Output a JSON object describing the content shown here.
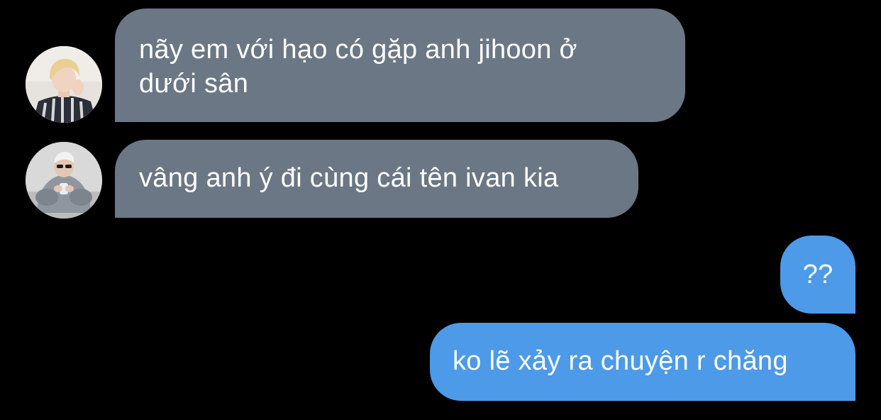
{
  "conversation": {
    "messages": [
      {
        "side": "incoming",
        "avatar_icon": "blonde-person-avatar-icon",
        "lines": [
          "nãy em với hạo có gặp anh jihoon ở",
          "dưới sân"
        ]
      },
      {
        "side": "incoming",
        "avatar_icon": "grey-hoodie-person-avatar-icon",
        "lines": [
          "vâng anh ý đi cùng cái tên ivan kia"
        ]
      },
      {
        "side": "outgoing",
        "lines": [
          "??"
        ]
      },
      {
        "side": "outgoing",
        "lines": [
          "ko lẽ xảy ra chuyện r chăng"
        ]
      }
    ]
  },
  "colors": {
    "background": "#000000",
    "incoming_bubble": "#6b7784",
    "outgoing_bubble": "#4c9ae8",
    "text": "#ffffff"
  }
}
